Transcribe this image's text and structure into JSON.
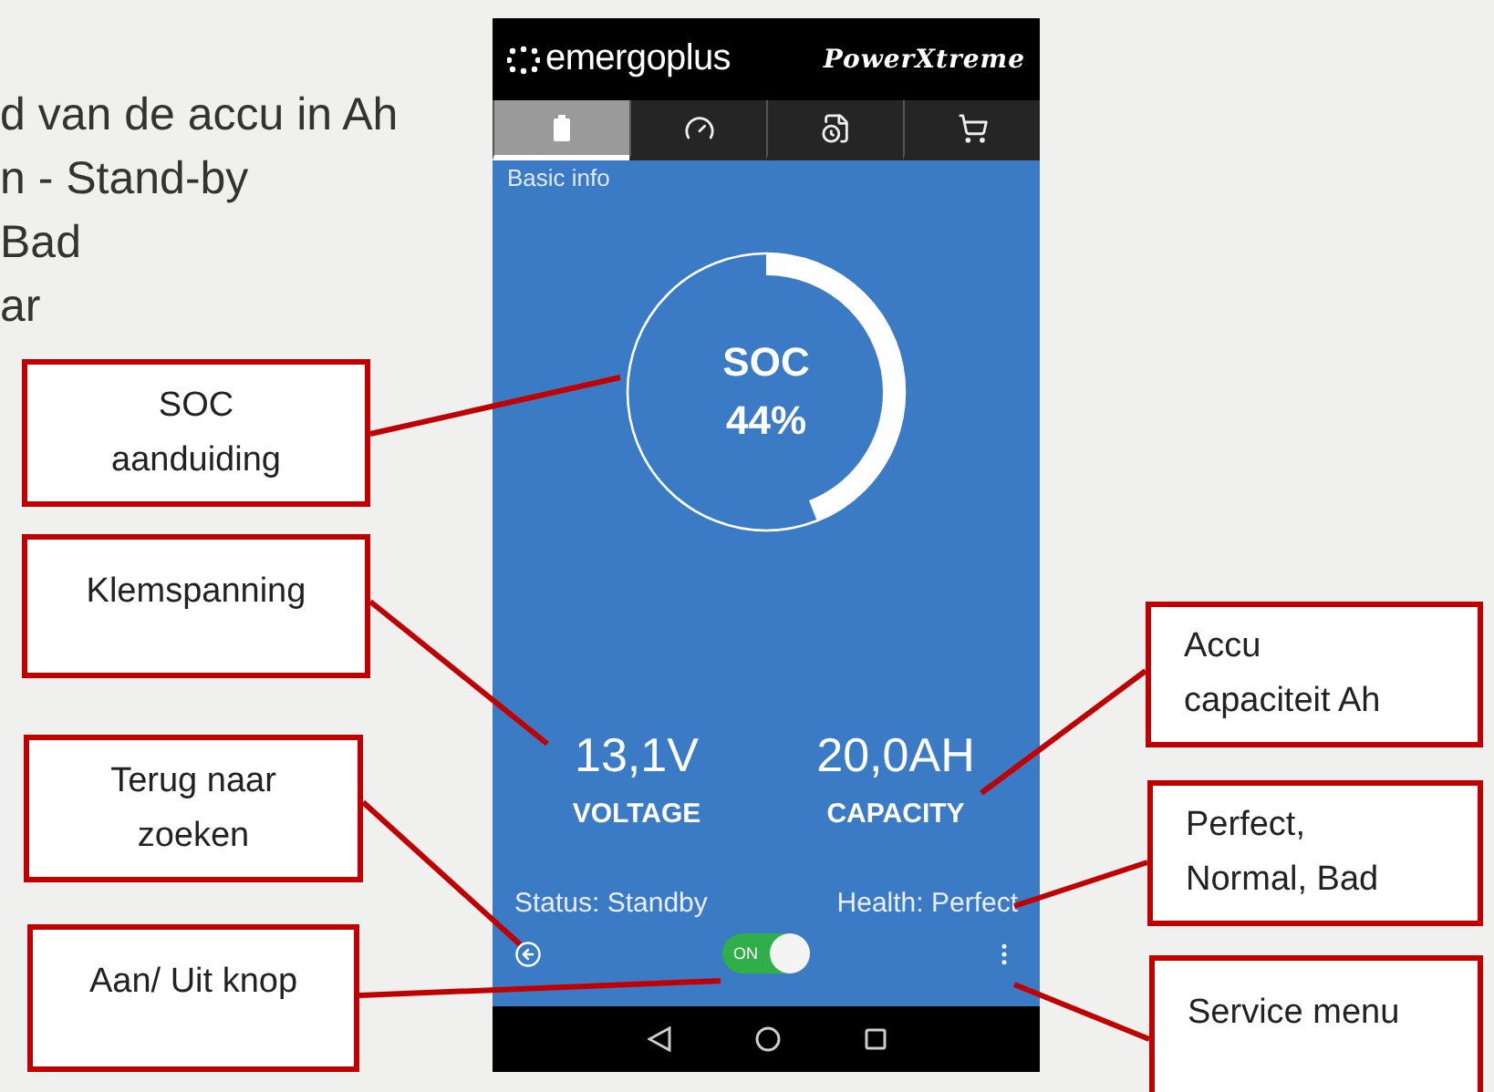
{
  "intro_lines": [
    "d van de accu in Ah",
    "n - Stand-by",
    "Bad",
    "ar"
  ],
  "phone": {
    "brand": "emergoplus",
    "product": "PowerXtreme",
    "tabs": [
      {
        "kind": "battery",
        "selected": true
      },
      {
        "kind": "gauge",
        "selected": false
      },
      {
        "kind": "log",
        "selected": false
      },
      {
        "kind": "cart",
        "selected": false
      }
    ],
    "section_title": "Basic info",
    "soc": {
      "label": "SOC",
      "value": "44%",
      "level": 0.44
    },
    "readings": [
      {
        "value": "13,1V",
        "label": "VOLTAGE"
      },
      {
        "value": "20,0AH",
        "label": "CAPACITY"
      }
    ],
    "status": "Status: Standby",
    "health": "Health: Perfect",
    "power_toggle": {
      "label": "ON",
      "on": true
    }
  },
  "callouts": [
    {
      "lines": [
        "SOC",
        "aanduiding"
      ]
    },
    {
      "lines": [
        "Klemspanning"
      ]
    },
    {
      "lines": [
        "Terug naar",
        "zoeken"
      ]
    },
    {
      "lines": [
        "Aan/ Uit knop"
      ]
    },
    {
      "lines": [
        "Accu",
        "capaciteit Ah"
      ]
    },
    {
      "lines": [
        "Perfect,",
        "Normal, Bad"
      ]
    },
    {
      "lines": [
        "Service menu"
      ]
    }
  ]
}
